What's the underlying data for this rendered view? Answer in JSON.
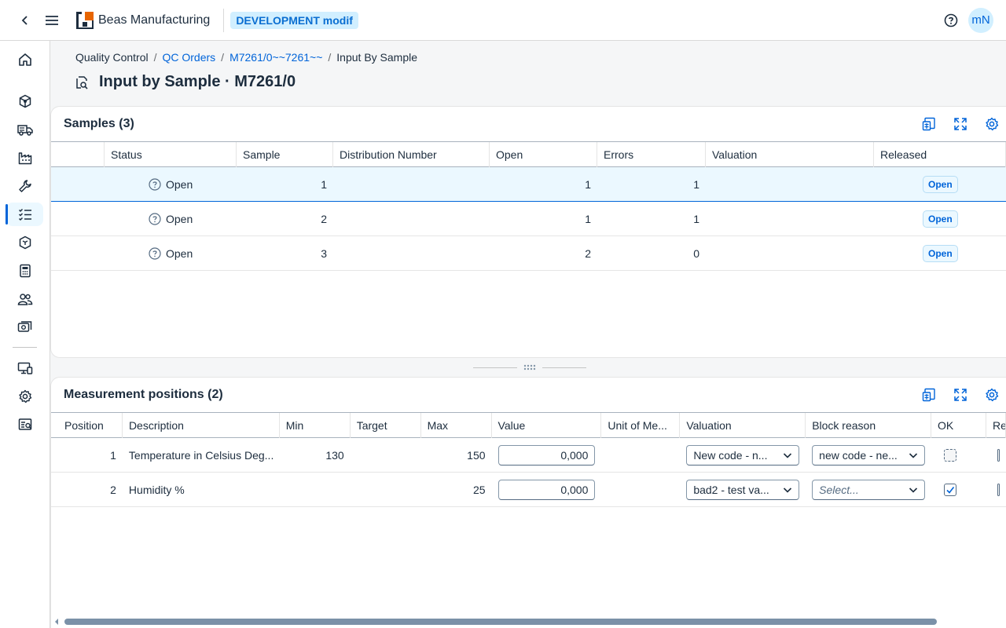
{
  "shell": {
    "app_name": "Beas Manufacturing",
    "environment": "DEVELOPMENT modif",
    "avatar_initials": "mN",
    "brand_color": "#0064d9"
  },
  "sidenav": {
    "items": [
      {
        "name": "home-icon",
        "active": false
      },
      {
        "name": "cube-icon",
        "active": false
      },
      {
        "name": "shipping-icon",
        "active": false
      },
      {
        "name": "factory-icon",
        "active": false
      },
      {
        "name": "wrench-icon",
        "active": false
      },
      {
        "name": "checklist-icon",
        "active": true
      },
      {
        "name": "product-icon",
        "active": false
      },
      {
        "name": "calculator-icon",
        "active": false
      },
      {
        "name": "people-icon",
        "active": false
      },
      {
        "name": "money-icon",
        "active": false
      },
      {
        "name": "desktop-mobile-icon",
        "active": false
      },
      {
        "name": "gear-icon",
        "active": false
      },
      {
        "name": "report-icon",
        "active": false
      }
    ]
  },
  "breadcrumb": {
    "items": [
      "Quality Control",
      "QC Orders",
      "M7261/0~~7261~~",
      "Input By Sample"
    ]
  },
  "page": {
    "title": "Input by Sample · M7261/0"
  },
  "samples": {
    "title": "Samples (3)",
    "columns": [
      "Status",
      "Sample",
      "Distribution Number",
      "Open",
      "Errors",
      "Valuation",
      "Released"
    ],
    "rows": [
      {
        "status": "Open",
        "sample": "1",
        "distribution": "",
        "open": "1",
        "errors": "1",
        "valuation": "",
        "released": "Open",
        "selected": true
      },
      {
        "status": "Open",
        "sample": "2",
        "distribution": "",
        "open": "1",
        "errors": "1",
        "valuation": "",
        "released": "Open",
        "selected": false
      },
      {
        "status": "Open",
        "sample": "3",
        "distribution": "",
        "open": "2",
        "errors": "0",
        "valuation": "",
        "released": "Open",
        "selected": false
      }
    ]
  },
  "measurements": {
    "title": "Measurement positions (2)",
    "columns": [
      "Position",
      "Description",
      "Min",
      "Target",
      "Max",
      "Value",
      "Unit of Me...",
      "Valuation",
      "Block reason",
      "OK",
      "Re"
    ],
    "rows": [
      {
        "position": "1",
        "description": "Temperature in Celsius Deg...",
        "min": "130",
        "target": "",
        "max": "150",
        "value": "0,000",
        "unit": "",
        "valuation": "New code - n...",
        "block_reason": "new code - ne...",
        "block_placeholder": false,
        "ok_checked": false
      },
      {
        "position": "2",
        "description": "Humidity %",
        "min": "",
        "target": "",
        "max": "25",
        "value": "0,000",
        "unit": "",
        "valuation": "bad2 - test va...",
        "block_reason": "Select...",
        "block_placeholder": true,
        "ok_checked": true
      }
    ]
  }
}
